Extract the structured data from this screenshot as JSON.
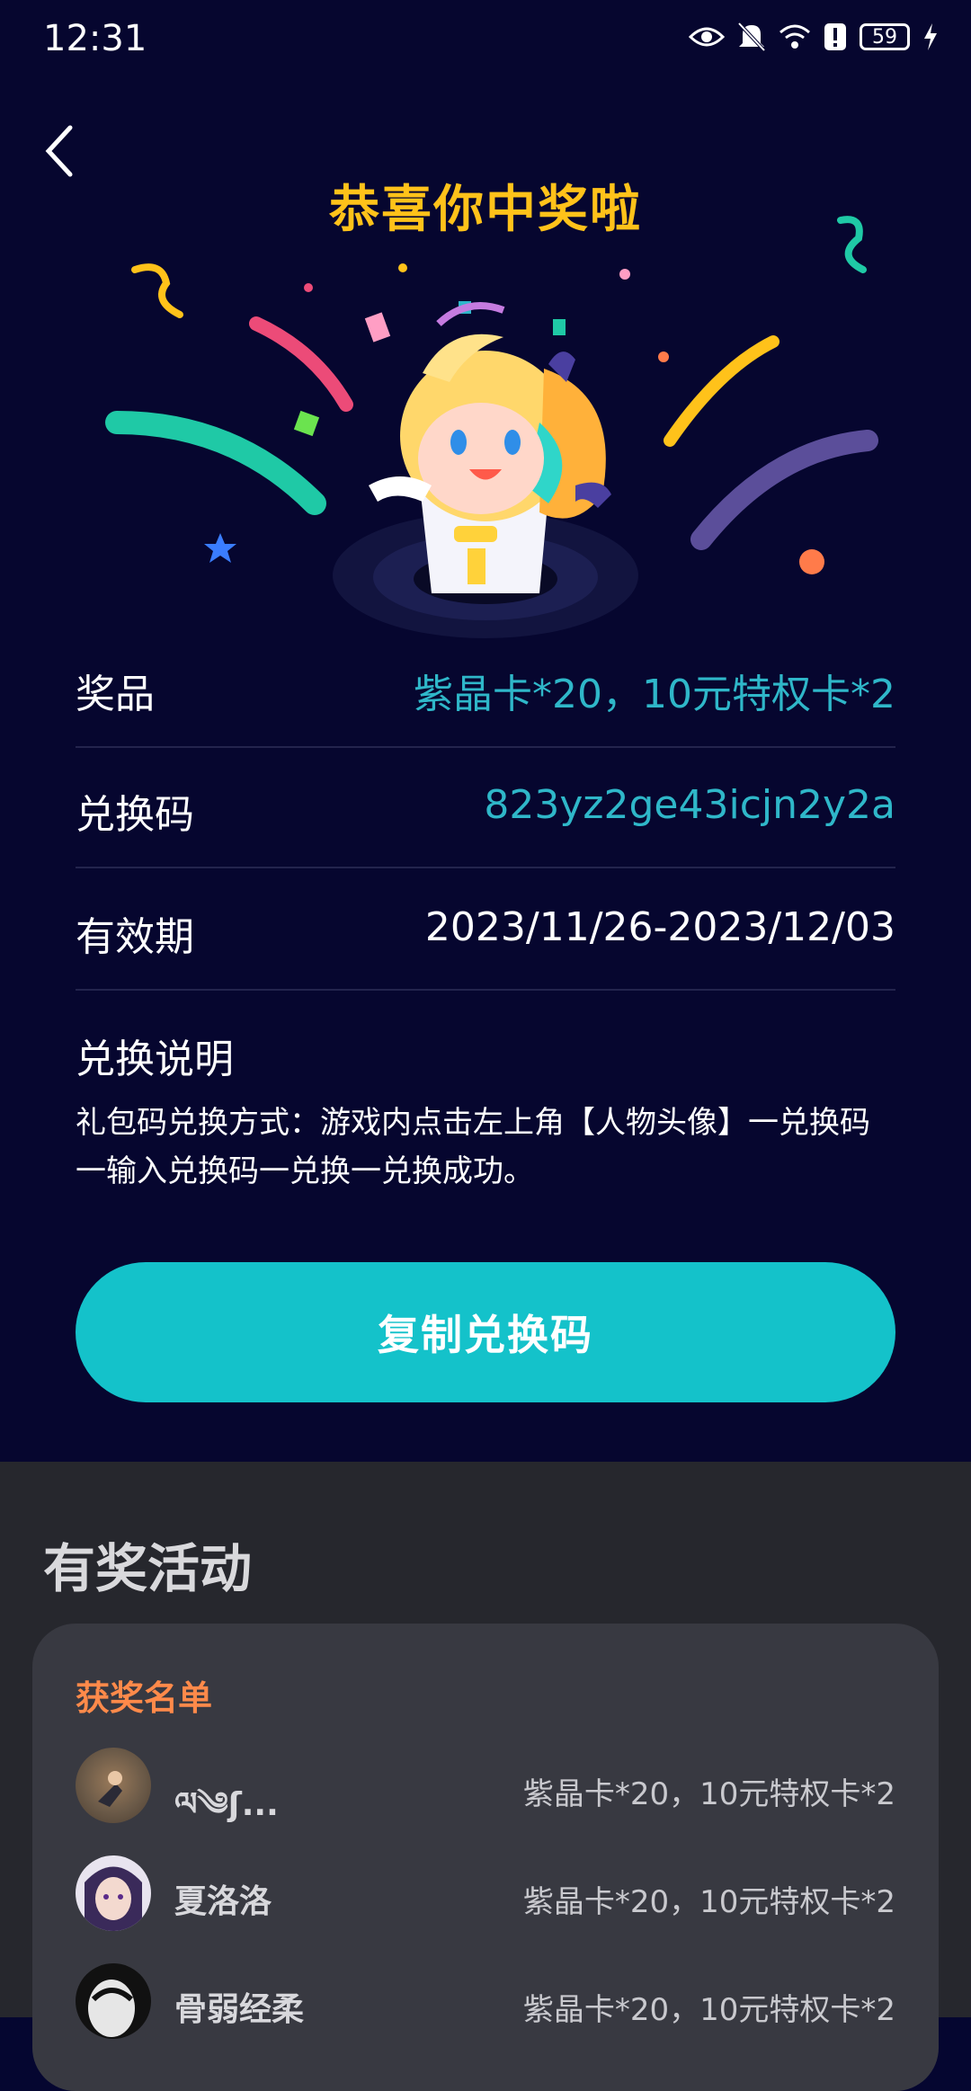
{
  "status_bar": {
    "time": "12:31",
    "battery": "59"
  },
  "header": {
    "title": "恭喜你中奖啦"
  },
  "details": {
    "prize_label": "奖品",
    "prize_value": "紫晶卡*20，10元特权卡*2",
    "code_label": "兑换码",
    "code_value": "823yz2ge43icjn2y2a",
    "validity_label": "有效期",
    "validity_value": "2023/11/26-2023/12/03",
    "instructions_title": "兑换说明",
    "instructions_text": "礼包码兑换方式：游戏内点击左上角【人物头像】一兑换码一输入兑换码一兑换一兑换成功。"
  },
  "copy_button": {
    "label": "复制兑换码"
  },
  "activities": {
    "title": "有奖活动",
    "winners_title": "获奖名单",
    "winners": [
      {
        "name": "ལ༄ʃ...",
        "prize": "紫晶卡*20，10元特权卡*2"
      },
      {
        "name": "夏洛洛",
        "prize": "紫晶卡*20，10元特权卡*2"
      },
      {
        "name": "骨弱经柔",
        "prize": "紫晶卡*20，10元特权卡*2"
      }
    ]
  },
  "colors": {
    "accent": "#14c2ca",
    "title": "#ffc21a",
    "link": "#2fb7c9",
    "winner_title": "#ff8a4a"
  }
}
